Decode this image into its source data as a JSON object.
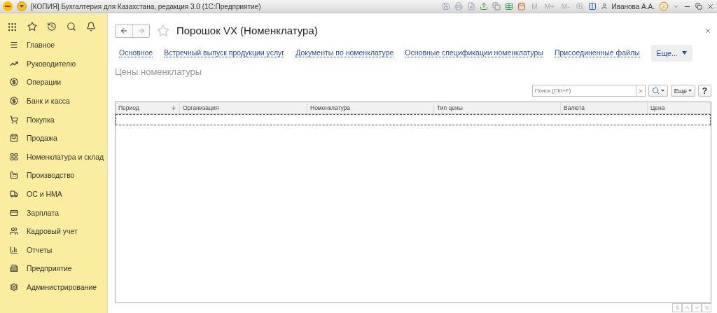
{
  "window": {
    "title": "[КОПИЯ] Бухгалтерия для Казахстана, редакция 3.0  (1С:Предприятие)",
    "memory_buttons": [
      "M",
      "M+",
      "M-"
    ],
    "user": "Иванова А.А."
  },
  "sidebar": {
    "items": [
      {
        "label": "Главное"
      },
      {
        "label": "Руководителю"
      },
      {
        "label": "Операции"
      },
      {
        "label": "Банк и касса"
      },
      {
        "label": "Покупка"
      },
      {
        "label": "Продажа"
      },
      {
        "label": "Номенклатура и склад"
      },
      {
        "label": "Производство"
      },
      {
        "label": "ОС и НМА"
      },
      {
        "label": "Зарплата"
      },
      {
        "label": "Кадровый учет"
      },
      {
        "label": "Отчеты"
      },
      {
        "label": "Предприятие"
      },
      {
        "label": "Администрирование"
      }
    ]
  },
  "form": {
    "title": "Порошок VX (Номенклатура)",
    "links": [
      "Основное",
      "Встречный выпуск продукции услуг",
      "Документы по номенклатуре",
      "Основные спецификации номенклатуры",
      "Присоединенные файлы"
    ],
    "more": "Еще...",
    "section_title": "Цены номенклатуры",
    "search": {
      "placeholder": "Поиск (Ctrl+F)"
    },
    "more_button": "Еще",
    "help_button": "?",
    "table": {
      "columns": [
        {
          "label": "Период",
          "sorted": true
        },
        {
          "label": "Организация",
          "sorted": false
        },
        {
          "label": "Номенклатура",
          "sorted": false
        },
        {
          "label": "Тип цены",
          "sorted": false
        },
        {
          "label": "Валюта",
          "sorted": false
        },
        {
          "label": "Цена",
          "sorted": false
        }
      ]
    }
  }
}
